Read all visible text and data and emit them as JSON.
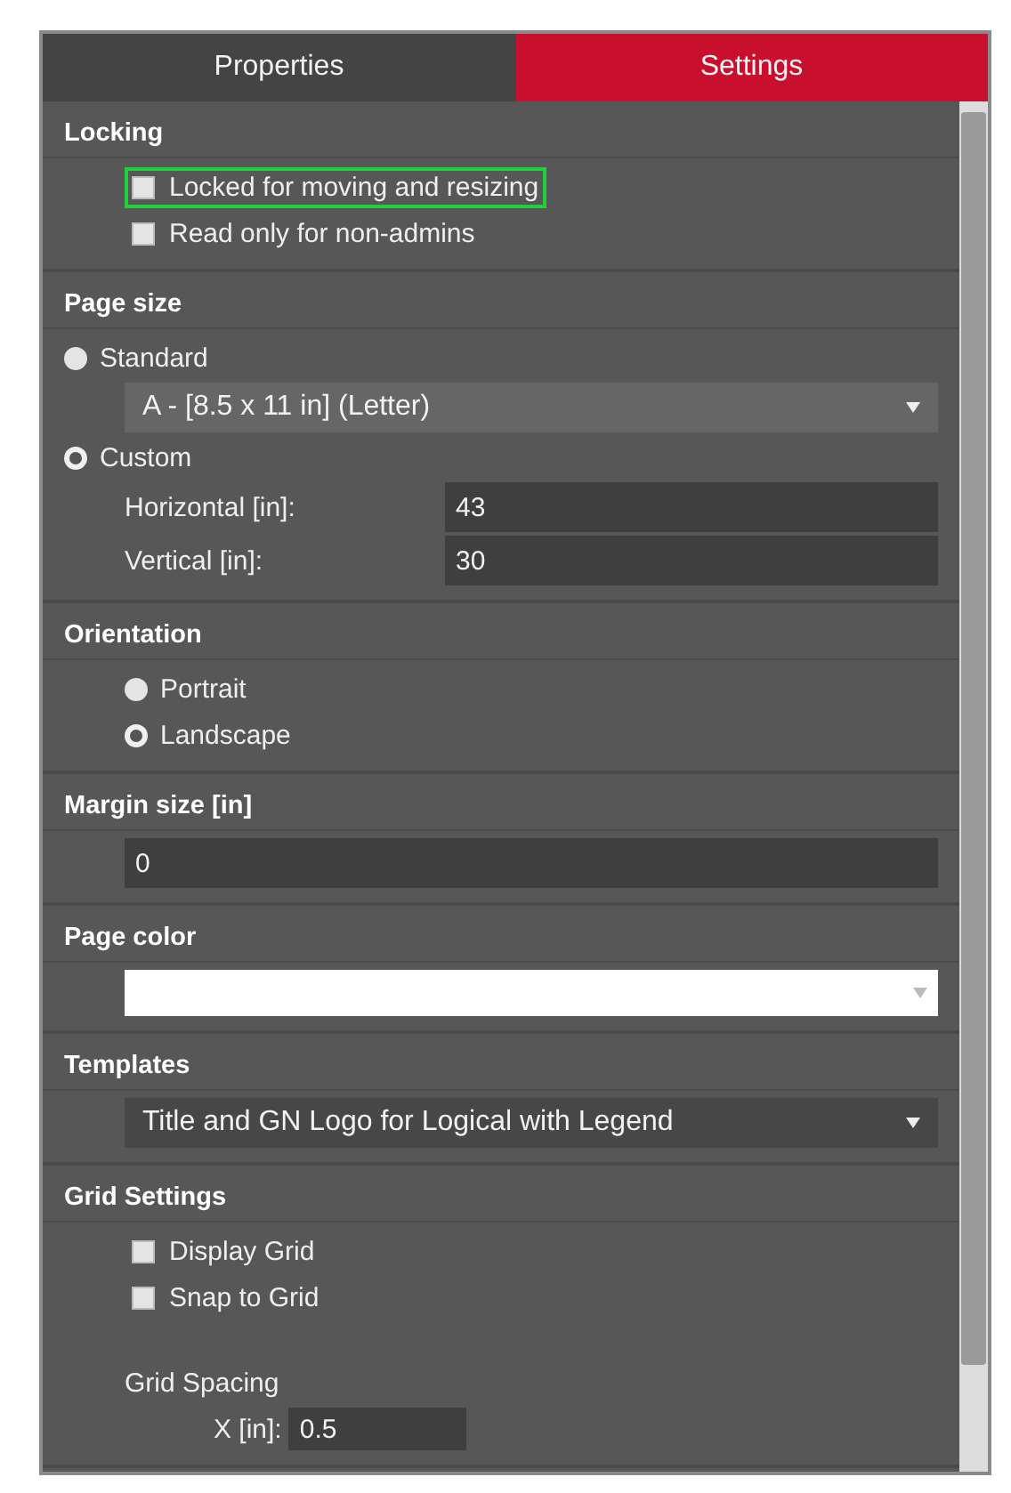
{
  "tabs": [
    {
      "label": "Properties",
      "selected": false
    },
    {
      "label": "Settings",
      "selected": true
    }
  ],
  "sections": [
    {
      "title": "Locking",
      "items": [
        {
          "kind": "checkbox",
          "label": "Locked for moving and resizing",
          "checked": false,
          "highlighted": true
        },
        {
          "kind": "checkbox",
          "label": "Read only for non-admins",
          "checked": false,
          "highlighted": false
        }
      ]
    },
    {
      "title": "Page size",
      "items": [
        {
          "kind": "radio_group",
          "label": "Standard",
          "selected": false,
          "children": [
            {
              "kind": "dropdown",
              "value": "A - [8.5 x 11 in] (Letter)"
            }
          ]
        },
        {
          "kind": "radio_group",
          "label": "Custom",
          "selected": true,
          "children": [
            {
              "kind": "field",
              "label": "Horizontal [in]:",
              "value": "43"
            },
            {
              "kind": "field",
              "label": "Vertical [in]:",
              "value": "30"
            }
          ]
        }
      ]
    },
    {
      "title": "Orientation",
      "items": [
        {
          "kind": "radio",
          "label": "Portrait",
          "selected": false
        },
        {
          "kind": "radio",
          "label": "Landscape",
          "selected": true
        }
      ]
    },
    {
      "title": "Margin size [in]",
      "items": [
        {
          "kind": "field",
          "value": "0"
        }
      ]
    },
    {
      "title": "Page color",
      "items": [
        {
          "kind": "color",
          "color": "#ffffff"
        }
      ]
    },
    {
      "title": "Templates",
      "items": [
        {
          "kind": "dropdown",
          "value": "Title and GN Logo for Logical with Legend"
        }
      ]
    },
    {
      "title": "Grid Settings",
      "items": [
        {
          "kind": "checkbox",
          "label": "Display Grid",
          "checked": false,
          "highlighted": false
        },
        {
          "kind": "checkbox",
          "label": "Snap to Grid",
          "checked": false,
          "highlighted": false
        },
        {
          "kind": "caption",
          "label": "Grid Spacing"
        },
        {
          "kind": "small_field",
          "label": "X [in]:",
          "value": "0.5"
        }
      ]
    }
  ]
}
